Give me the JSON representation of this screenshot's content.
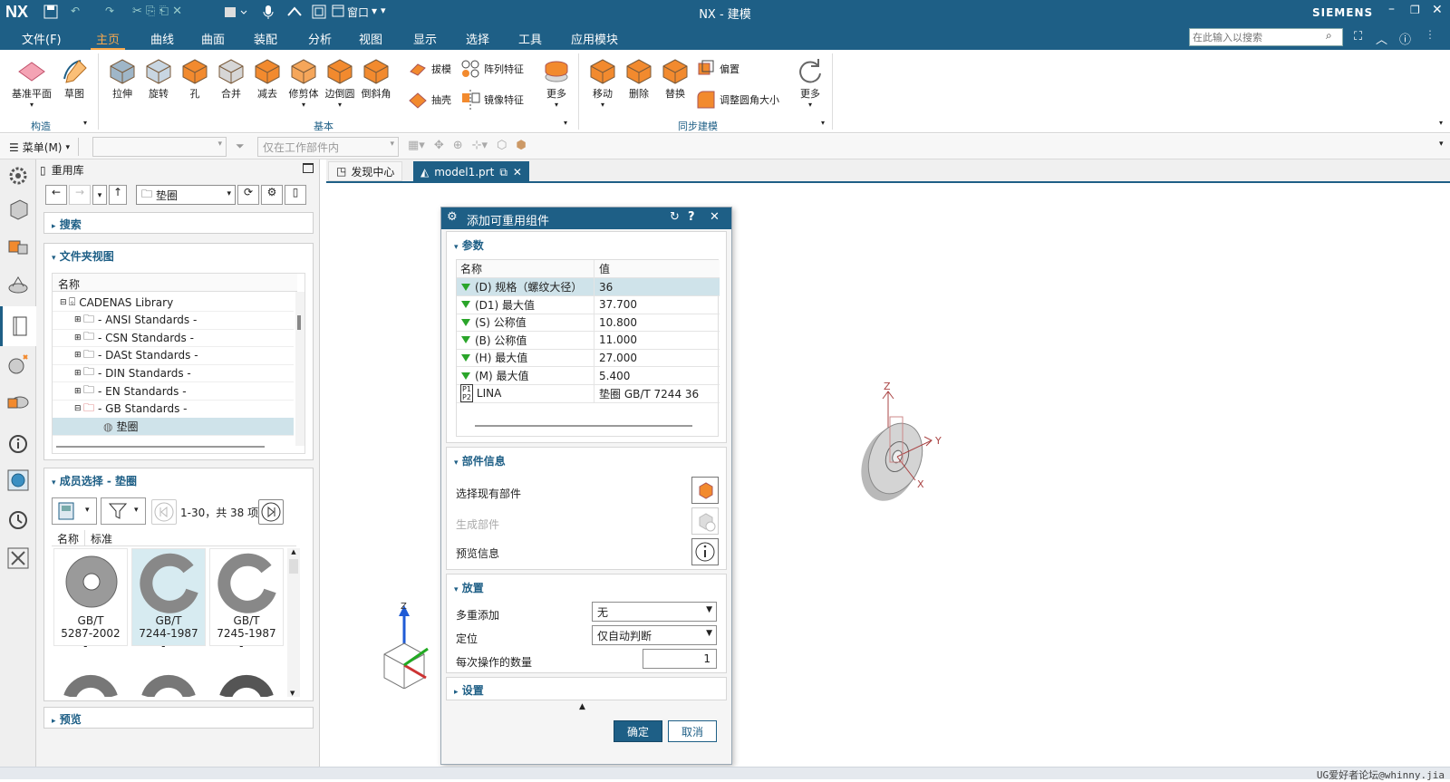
{
  "title_bar": {
    "logo": "NX",
    "title": "NX - 建模",
    "brand": "SIEMENS",
    "window_menu": "窗口"
  },
  "menu": [
    "文件(F)",
    "主页",
    "曲线",
    "曲面",
    "装配",
    "分析",
    "视图",
    "显示",
    "选择",
    "工具",
    "应用模块"
  ],
  "active_menu": "主页",
  "search": {
    "placeholder": "在此输入以搜索"
  },
  "ribbon": {
    "construct": {
      "items": [
        "基准平面",
        "草图"
      ],
      "group": "构造"
    },
    "basic": {
      "items": [
        "拉伸",
        "旋转",
        "孔",
        "合并",
        "减去",
        "修剪体",
        "边倒圆",
        "倒斜角"
      ],
      "small": [
        "拔模",
        "阵列特征",
        "抽壳",
        "镜像特征"
      ],
      "more": "更多",
      "group": "基本"
    },
    "sync": {
      "items": [
        "移动",
        "删除",
        "替换"
      ],
      "small": [
        "偏置",
        "调整圆角大小"
      ],
      "more": "更多",
      "group": "同步建模"
    }
  },
  "selection_bar": {
    "menu": "菜单(M)",
    "filter": "",
    "scope": "仅在工作部件内"
  },
  "reuse_panel": {
    "title": "重用库",
    "path": "垫圈",
    "search_section": "搜索",
    "folder_view": "文件夹视图",
    "tree_header": "名称",
    "tree": [
      "CADENAS Library",
      "- ANSI Standards -",
      "- CSN Standards -",
      "- DASt Standards -",
      "- DIN Standards -",
      "- EN Standards -",
      "- GB Standards -",
      "垫圈"
    ],
    "member_section": "成员选择 - 垫圈",
    "count": "1-30，共 38 项",
    "member_cols": [
      "名称",
      "标准"
    ],
    "thumbs": [
      {
        "l1": "GB/T",
        "l2": "5287-2002 -..."
      },
      {
        "l1": "GB/T",
        "l2": "7244-1987 -..."
      },
      {
        "l1": "GB/T",
        "l2": "7245-1987 -..."
      }
    ],
    "preview_section": "预览"
  },
  "tabs": [
    {
      "label": "发现中心"
    },
    {
      "label": "model1.prt"
    }
  ],
  "dialog": {
    "title": "添加可重用组件",
    "params_section": "参数",
    "cols": [
      "名称",
      "值"
    ],
    "rows": [
      {
        "name": "(D) 规格（螺纹大径）",
        "value": "36"
      },
      {
        "name": "(D1) 最大值",
        "value": "37.700"
      },
      {
        "name": "(S) 公称值",
        "value": "10.800"
      },
      {
        "name": "(B) 公称值",
        "value": "11.000"
      },
      {
        "name": "(H) 最大值",
        "value": "27.000"
      },
      {
        "name": "(M) 最大值",
        "value": "5.400"
      },
      {
        "name": "LINA",
        "value": "垫圈 GB/T 7244 36"
      }
    ],
    "part_info": "部件信息",
    "select_existing": "选择现有部件",
    "generate": "生成部件",
    "preview_info": "预览信息",
    "placement": "放置",
    "multi_add": "多重添加",
    "multi_add_val": "无",
    "positioning": "定位",
    "positioning_val": "仅自动判断",
    "quantity": "每次操作的数量",
    "quantity_val": "1",
    "settings": "设置",
    "ok": "确定",
    "cancel": "取消"
  },
  "axes": {
    "x": "X",
    "y": "Y",
    "z": "Z"
  },
  "watermark": "UG爱好者论坛@whinny.jia",
  "colors": {
    "brand": "#1e5f86",
    "accent": "#f28a2e",
    "green": "#2aa52a"
  }
}
